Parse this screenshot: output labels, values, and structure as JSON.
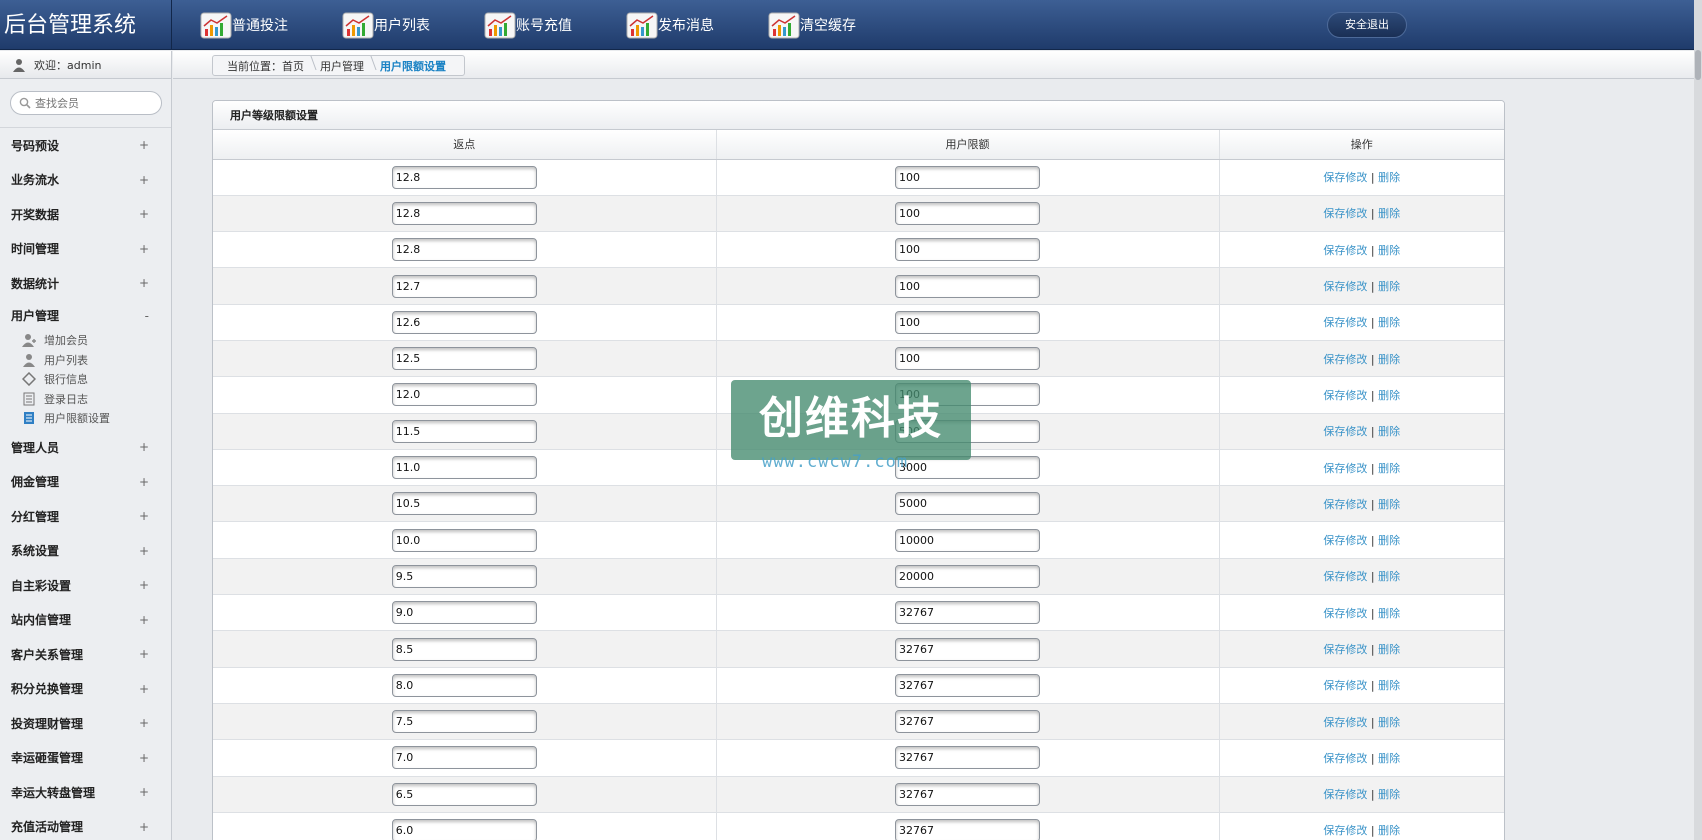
{
  "header": {
    "brand": "后台管理系统",
    "nav": [
      {
        "label": "普通投注",
        "icon": "chart-icon"
      },
      {
        "label": "用户列表",
        "icon": "chart-icon"
      },
      {
        "label": "账号充值",
        "icon": "chart-icon"
      },
      {
        "label": "发布消息",
        "icon": "chart-icon"
      },
      {
        "label": "清空缓存",
        "icon": "chart-icon"
      }
    ],
    "logout_label": "安全退出"
  },
  "sidebar": {
    "welcome": "欢迎：admin",
    "search_placeholder": "查找会员",
    "menu_before": [
      {
        "label": "号码预设",
        "mark": "+"
      },
      {
        "label": "业务流水",
        "mark": "+"
      },
      {
        "label": "开奖数据",
        "mark": "+"
      },
      {
        "label": "时间管理",
        "mark": "+"
      },
      {
        "label": "数据统计",
        "mark": "+"
      }
    ],
    "expanded": {
      "label": "用户管理",
      "mark": "-"
    },
    "subitems": [
      {
        "label": "增加会员",
        "icon": "user-add-icon"
      },
      {
        "label": "用户列表",
        "icon": "user-icon"
      },
      {
        "label": "银行信息",
        "icon": "bank-icon"
      },
      {
        "label": "登录日志",
        "icon": "log-icon"
      },
      {
        "label": "用户限额设置",
        "icon": "limit-icon"
      }
    ],
    "menu_after": [
      {
        "label": "管理人员",
        "mark": "+"
      },
      {
        "label": "佣金管理",
        "mark": "+"
      },
      {
        "label": "分红管理",
        "mark": "+"
      },
      {
        "label": "系统设置",
        "mark": "+"
      },
      {
        "label": "自主彩设置",
        "mark": "+"
      },
      {
        "label": "站内信管理",
        "mark": "+"
      },
      {
        "label": "客户关系管理",
        "mark": "+"
      },
      {
        "label": "积分兑换管理",
        "mark": "+"
      },
      {
        "label": "投资理财管理",
        "mark": "+"
      },
      {
        "label": "幸运砸蛋管理",
        "mark": "+"
      },
      {
        "label": "幸运大转盘管理",
        "mark": "+"
      },
      {
        "label": "充值活动管理",
        "mark": "+"
      }
    ]
  },
  "breadcrumb": {
    "prefix": "当前位置：首页",
    "level1": "用户管理",
    "current": "用户限额设置"
  },
  "panel": {
    "title": "用户等级限额设置",
    "columns": [
      "返点",
      "用户限额",
      "操作"
    ],
    "save_label": "保存修改",
    "separator": "|",
    "delete_label": "删除",
    "rows": [
      {
        "rebate": "12.8",
        "limit": "100"
      },
      {
        "rebate": "12.8",
        "limit": "100"
      },
      {
        "rebate": "12.8",
        "limit": "100"
      },
      {
        "rebate": "12.7",
        "limit": "100"
      },
      {
        "rebate": "12.6",
        "limit": "100"
      },
      {
        "rebate": "12.5",
        "limit": "100"
      },
      {
        "rebate": "12.0",
        "limit": "100"
      },
      {
        "rebate": "11.5",
        "limit": "500"
      },
      {
        "rebate": "11.0",
        "limit": "3000"
      },
      {
        "rebate": "10.5",
        "limit": "5000"
      },
      {
        "rebate": "10.0",
        "limit": "10000"
      },
      {
        "rebate": "9.5",
        "limit": "20000"
      },
      {
        "rebate": "9.0",
        "limit": "32767"
      },
      {
        "rebate": "8.5",
        "limit": "32767"
      },
      {
        "rebate": "8.0",
        "limit": "32767"
      },
      {
        "rebate": "7.5",
        "limit": "32767"
      },
      {
        "rebate": "7.0",
        "limit": "32767"
      },
      {
        "rebate": "6.5",
        "limit": "32767"
      },
      {
        "rebate": "6.0",
        "limit": "32767"
      }
    ]
  },
  "watermark": {
    "text": "创维科技",
    "url": "www.cwcw7.com"
  },
  "colors": {
    "header": "#2b4a7c",
    "link": "#3a93c8",
    "active_crumb": "#1a82c4"
  }
}
